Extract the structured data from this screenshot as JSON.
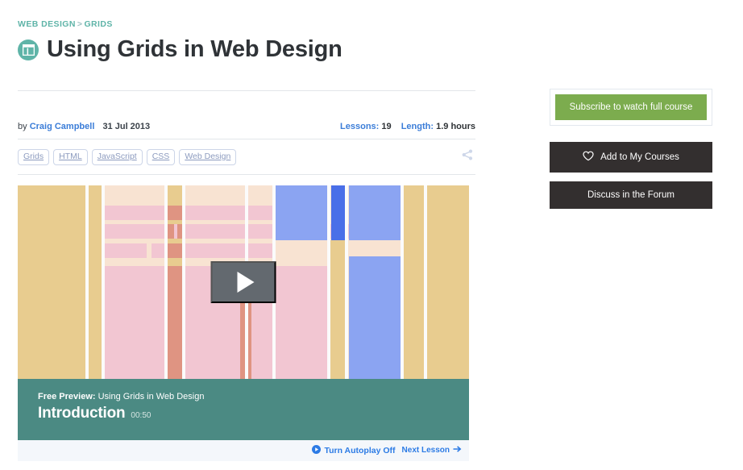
{
  "breadcrumb": {
    "root": "WEB DESIGN",
    "separator": ">",
    "current": "GRIDS"
  },
  "header": {
    "title": "Using Grids in Web Design",
    "icon": "grid-layout-icon"
  },
  "meta": {
    "by_label": "by",
    "author": "Craig Campbell",
    "date": "31 Jul 2013",
    "lessons_label": "Lessons:",
    "lessons_value": "19",
    "length_label": "Length:",
    "length_value": "1.9 hours"
  },
  "tags": [
    "Grids",
    "HTML",
    "JavaScript",
    "CSS",
    "Web Design"
  ],
  "share": {
    "icon": "share-icon"
  },
  "video": {
    "play_icon": "play-triangle-icon",
    "preview_label": "Free Preview:",
    "preview_course": "Using Grids in Web Design",
    "lesson_title": "Introduction",
    "duration": "00:50"
  },
  "autoplay": {
    "toggle_icon": "circle-play-icon",
    "toggle_label": "Turn Autoplay Off",
    "next_label": "Next Lesson",
    "next_icon": "arrow-right-icon"
  },
  "sidebar": {
    "subscribe_label": "Subscribe to watch full course",
    "add_courses_label": "Add to My Courses",
    "add_courses_icon": "heart-icon",
    "forum_label": "Discuss in the Forum"
  },
  "colors": {
    "accent_teal": "#5fb4a8",
    "caption_teal": "#4b8a83",
    "link_blue": "#2c7be5",
    "subscribe_green": "#7cac4e",
    "dark_button": "#332f2f",
    "thumb_sand": "#e8cc8f",
    "thumb_pink": "#f2c6d2",
    "thumb_blue": "#8ba4f2",
    "thumb_blue_dark": "#4a6fe8",
    "thumb_cream": "#f8e3d2",
    "thumb_salmon": "#df9482"
  }
}
